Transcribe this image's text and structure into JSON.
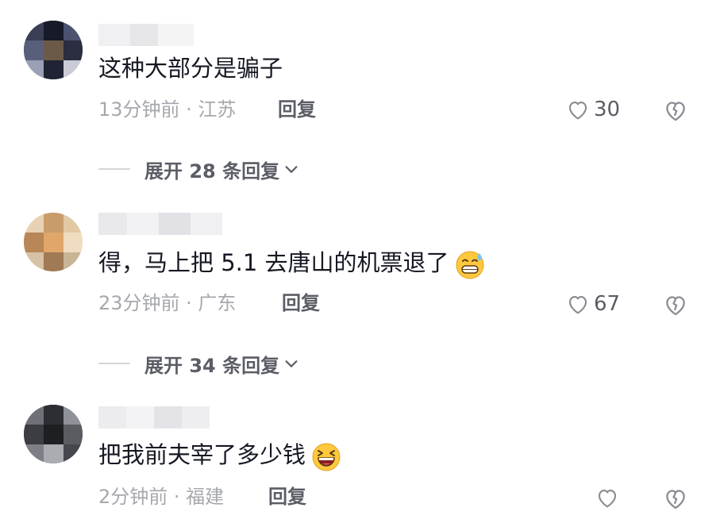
{
  "comments": [
    {
      "text": "这种大部分是骗子",
      "time_location": "13分钟前 · 江苏",
      "reply_label": "回复",
      "likes": "30",
      "expand_label": "展开 28 条回复"
    },
    {
      "text": "得，马上把 5.1 去唐山的机票退了",
      "time_location": "23分钟前 · 广东",
      "reply_label": "回复",
      "likes": "67",
      "expand_label": "展开 34 条回复"
    },
    {
      "text": "把我前夫宰了多少钱",
      "time_location": "2分钟前 · 福建",
      "reply_label": "回复",
      "likes": ""
    }
  ],
  "icons": {
    "like": "heart-outline-icon",
    "dislike": "broken-heart-icon",
    "expand": "chevron-down-icon",
    "emoji_1": "grinning-sweat-emoji",
    "emoji_2": "laughing-emoji"
  },
  "colors": {
    "text_primary": "#161823",
    "text_secondary": "#a6a8ad",
    "action_text": "#5b5d66",
    "emoji_yellow": "#ffc83d"
  }
}
